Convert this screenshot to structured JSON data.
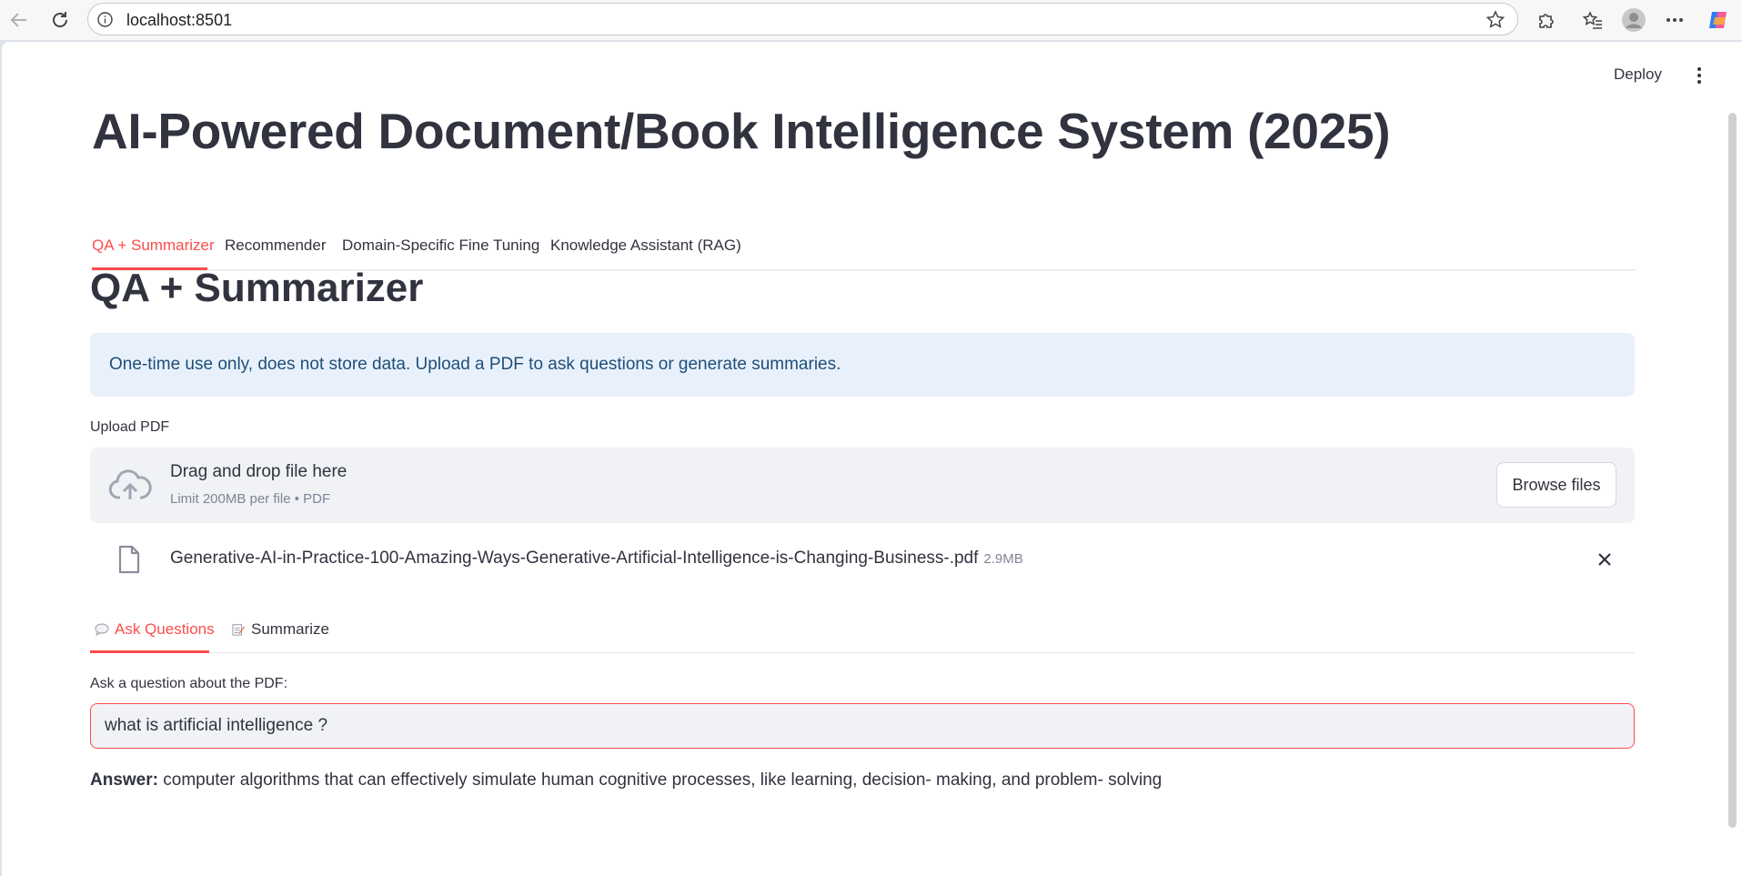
{
  "browser": {
    "url": "localhost:8501"
  },
  "header": {
    "deploy_label": "Deploy"
  },
  "page": {
    "title": "AI-Powered Document/Book Intelligence System (2025)"
  },
  "tabs": [
    {
      "label": "QA + Summarizer",
      "active": true
    },
    {
      "label": "Recommender",
      "active": false
    },
    {
      "label": "Domain-Specific Fine Tuning",
      "active": false
    },
    {
      "label": "Knowledge Assistant (RAG)",
      "active": false
    }
  ],
  "section": {
    "heading": "QA + Summarizer",
    "info": "One-time use only, does not store data. Upload a PDF to ask questions or generate summaries."
  },
  "uploader": {
    "label": "Upload PDF",
    "drag_text": "Drag and drop file here",
    "limit_text": "Limit 200MB per file • PDF",
    "browse_label": "Browse files"
  },
  "file": {
    "name": "Generative-AI-in-Practice-100-Amazing-Ways-Generative-Artificial-Intelligence-is-Changing-Business-.pdf",
    "size": "2.9MB"
  },
  "subtabs": [
    {
      "label": "Ask Questions",
      "active": true
    },
    {
      "label": "Summarize",
      "active": false
    }
  ],
  "question": {
    "label": "Ask a question about the PDF:",
    "value": "what is artificial intelligence ?"
  },
  "answer": {
    "label": "Answer:",
    "text": " computer algorithms that can effectively simulate human cognitive processes, like learning, decision- making, and problem- solving"
  },
  "colors": {
    "accent": "#ff4b4b",
    "info_bg": "#e8f1fb",
    "info_text": "#1f4e79",
    "text": "#31333f"
  }
}
